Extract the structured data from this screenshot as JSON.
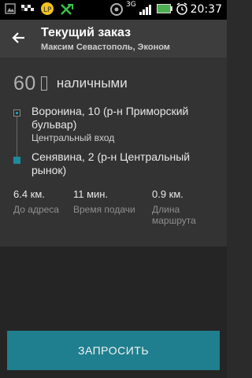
{
  "status_bar": {
    "time": "20:37",
    "network": "3G",
    "icons": [
      "image-icon",
      "taxi-icon",
      "lp-app-icon",
      "crossed-arrows-icon",
      "signal-icon",
      "network-3g-icon",
      "battery-icon",
      "alarm-icon"
    ]
  },
  "header": {
    "title": "Текущий заказ",
    "subtitle": "Максим Севастополь, Эконом"
  },
  "price": {
    "amount": "60",
    "method": "наличными"
  },
  "route": {
    "from_line": "Воронина, 10 (р-н Приморский бульвар)",
    "from_entrance": "Центральный вход",
    "to_line": "Сенявина, 2 (р-н Центральный рынок)"
  },
  "stats": [
    {
      "value": "6.4 км.",
      "label": "До адреса"
    },
    {
      "value": "11 мин.",
      "label": "Время подачи"
    },
    {
      "value": "0.9 км.",
      "label": "Длина маршрута"
    }
  ],
  "actions": {
    "request_label": "ЗАПРОСИТЬ"
  },
  "colors": {
    "accent": "#1f7f8e",
    "action_bar": "#3d3d3d",
    "content_bg": "#333333",
    "lower_bg": "#252525",
    "battery": "#4caf50"
  }
}
